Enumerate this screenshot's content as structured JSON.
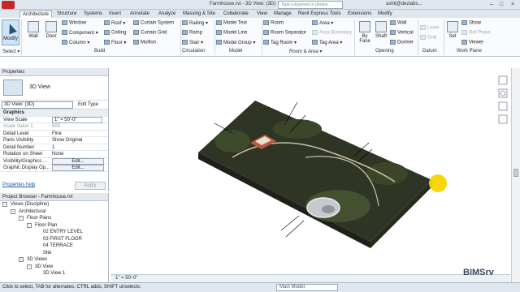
{
  "title_bar": {
    "document_title": "Farmhouse.rvt - 3D View: {3D}",
    "search_placeholder": "Type a keyword or phrase",
    "user": "ashit@dezlabs...",
    "minimize": "–",
    "maximize": "□",
    "close": "×"
  },
  "tabs": [
    "Architecture",
    "Structure",
    "Systems",
    "Insert",
    "Annotate",
    "Analyze",
    "Massing & Site",
    "Collaborate",
    "View",
    "Manage",
    "Revit Express Tools",
    "Extensions",
    "Modify"
  ],
  "ribbon": {
    "select": {
      "modify": "Modify",
      "label": "Select ▾"
    },
    "build": {
      "big": [
        "Wall",
        "Door",
        "Window"
      ],
      "small": [
        "Component ▾",
        "Column ▾",
        "Roof ▾",
        "Ceiling",
        "Floor ▾",
        "Curtain System",
        "Curtain Grid",
        "Mullion"
      ],
      "label": "Build"
    },
    "circulation": {
      "items": [
        "Railing ▾",
        "Ramp",
        "Stair ▾"
      ],
      "label": "Circulation"
    },
    "model": {
      "items": [
        "Model Text",
        "Model Line",
        "Model Group ▾"
      ],
      "label": "Model"
    },
    "room_area": {
      "items": [
        "Room",
        "Room Separator",
        "Tag Room ▾",
        "Area ▾",
        "Area Boundary",
        "Tag Area ▾"
      ],
      "label": "Room & Area ▾"
    },
    "opening": {
      "big": [
        "By Face",
        "Shaft"
      ],
      "small": [
        "Wall",
        "Vertical",
        "Dormer"
      ],
      "label": "Opening"
    },
    "datum": {
      "items": [
        "Level",
        "Grid"
      ],
      "label": "Datum"
    },
    "work_plane": {
      "big": "Set",
      "small": [
        "Show",
        "Ref Plane",
        "Viewer"
      ],
      "label": "Work Plane"
    }
  },
  "properties": {
    "header": "Properties",
    "type_name": "3D View",
    "selector": "3D View: {3D}",
    "edit_type": "Edit Type",
    "group": "Graphics",
    "rows": [
      {
        "k": "View Scale",
        "v": "1\" = 50'-0\""
      },
      {
        "k": "Scale Value   1:",
        "v": "600"
      },
      {
        "k": "Detail Level",
        "v": "Fine"
      },
      {
        "k": "Parts Visibility",
        "v": "Show Original"
      },
      {
        "k": "Detail Number",
        "v": "1"
      },
      {
        "k": "Rotation on Sheet",
        "v": "None"
      },
      {
        "k": "Visibility/Graphics ...",
        "v": "Edit..."
      },
      {
        "k": "Graphic Display Op...",
        "v": "Edit..."
      }
    ],
    "help": "Properties help",
    "apply": "Apply"
  },
  "browser": {
    "header": "Project Browser - Farmhouse.rvt",
    "nodes": [
      {
        "label": "Views (Discipline)",
        "level": 0,
        "toggle": "-"
      },
      {
        "label": "Architectural",
        "level": 1,
        "toggle": "-"
      },
      {
        "label": "Floor Plans",
        "level": 2,
        "toggle": "-"
      },
      {
        "label": "Floor Plan",
        "level": 3,
        "toggle": "-"
      },
      {
        "label": "02 ENTRY LEVEL",
        "level": 4,
        "toggle": ""
      },
      {
        "label": "03 FIRST FLOOR",
        "level": 4,
        "toggle": ""
      },
      {
        "label": "04 TERRACE",
        "level": 4,
        "toggle": ""
      },
      {
        "label": "Site",
        "level": 4,
        "toggle": ""
      },
      {
        "label": "3D Views",
        "level": 2,
        "toggle": "-"
      },
      {
        "label": "3D View",
        "level": 3,
        "toggle": "-"
      },
      {
        "label": "3D View 1",
        "level": 4,
        "toggle": ""
      }
    ]
  },
  "canvas": {
    "scale": "1\" = 50'-0\""
  },
  "status": {
    "text": "Click to select, TAB for alternates, CTRL adds, SHIFT unselects.",
    "model": "Main Model"
  },
  "watermark": "BIMSrv",
  "colors": {
    "terrain": "#2e3524",
    "accent": "#c62828",
    "cursor": "#f5d400"
  }
}
